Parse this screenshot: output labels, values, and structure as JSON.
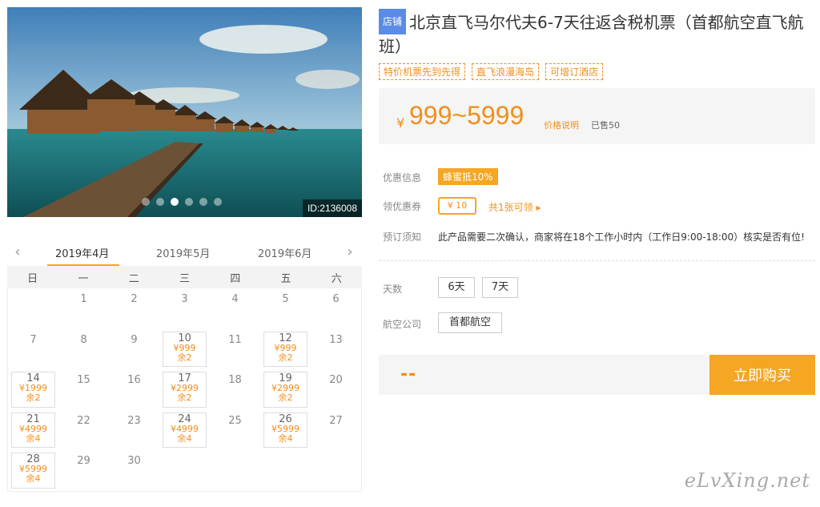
{
  "hero": {
    "id_label": "ID:2136008",
    "dots": 6,
    "active_dot": 3
  },
  "calendar": {
    "months": [
      "2019年4月",
      "2019年5月",
      "2019年6月"
    ],
    "weekdays": [
      "日",
      "一",
      "二",
      "三",
      "四",
      "五",
      "六"
    ],
    "cells": [
      {
        "d": ""
      },
      {
        "d": "1"
      },
      {
        "d": "2"
      },
      {
        "d": "3"
      },
      {
        "d": "4"
      },
      {
        "d": "5"
      },
      {
        "d": "6"
      },
      {
        "d": "7"
      },
      {
        "d": "8"
      },
      {
        "d": "9"
      },
      {
        "d": "10",
        "p": "¥999",
        "r": "余2"
      },
      {
        "d": "11"
      },
      {
        "d": "12",
        "p": "¥999",
        "r": "余2"
      },
      {
        "d": "13"
      },
      {
        "d": "14",
        "p": "¥1999",
        "r": "余2"
      },
      {
        "d": "15"
      },
      {
        "d": "16"
      },
      {
        "d": "17",
        "p": "¥2999",
        "r": "余2"
      },
      {
        "d": "18"
      },
      {
        "d": "19",
        "p": "¥2999",
        "r": "余2"
      },
      {
        "d": "20"
      },
      {
        "d": "21",
        "p": "¥4999",
        "r": "余4"
      },
      {
        "d": "22"
      },
      {
        "d": "23"
      },
      {
        "d": "24",
        "p": "¥4999",
        "r": "余4"
      },
      {
        "d": "25"
      },
      {
        "d": "26",
        "p": "¥5999",
        "r": "余4"
      },
      {
        "d": "27"
      },
      {
        "d": "28",
        "p": "¥5999",
        "r": "余4"
      },
      {
        "d": "29"
      },
      {
        "d": "30"
      },
      {
        "d": ""
      },
      {
        "d": ""
      },
      {
        "d": ""
      },
      {
        "d": ""
      }
    ]
  },
  "product": {
    "shop_badge": "店铺",
    "title": "北京直飞马尔代夫6-7天往返含税机票（首都航空直飞航班）",
    "tags": [
      "特价机票先到先得",
      "直飞浪漫海岛",
      "可增订酒店"
    ],
    "price_yen": "¥",
    "price_range": "999~5999",
    "price_explain": "价格说明",
    "sold": "已售50"
  },
  "info": {
    "promo_label": "优惠信息",
    "promo_badge": "蜂蜜抵10%",
    "coupon_label": "领优惠券",
    "coupon_value": "¥ 10",
    "coupon_link": "共1张可领 ▸",
    "notice_label": "预订须知",
    "notice_text": "此产品需要二次确认，商家将在18个工作小时内（工作日9:00-18:00）核实是否有位!"
  },
  "options": {
    "days_label": "天数",
    "days": [
      "6天",
      "7天"
    ],
    "airline_label": "航空公司",
    "airline": "首都航空"
  },
  "buy": {
    "placeholder": "--",
    "button": "立即购买"
  },
  "watermark": "eLvXing.net",
  "colors": {
    "accent": "#f5a623",
    "price": "#f08f1c",
    "shop_badge": "#5a8be6"
  }
}
